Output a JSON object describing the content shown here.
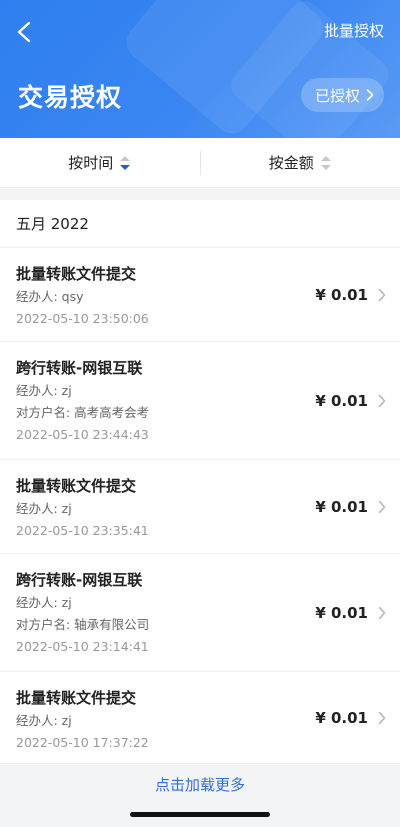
{
  "header": {
    "back_icon": "chevron-left-icon",
    "batch_auth_label": "批量授权",
    "title": "交易授权",
    "authorized_label": "已授权",
    "colors": {
      "header_blue": "#3a86f2",
      "link_blue": "#2f6fd6",
      "sort_active": "#1f5fc7"
    }
  },
  "sort_bar": {
    "items": [
      {
        "label": "按时间",
        "state": "descending"
      },
      {
        "label": "按金额",
        "state": "none"
      }
    ]
  },
  "list": {
    "month": "五月 2022",
    "rows": [
      {
        "title": "批量转账文件提交",
        "handler": "经办人: qsy",
        "counterparty": "",
        "time": "2022-05-10 23:50:06",
        "amount": "¥ 0.01"
      },
      {
        "title": "跨行转账-网银互联",
        "handler": "经办人: zj",
        "counterparty": "对方户名: 高考高考会考",
        "time": "2022-05-10 23:44:43",
        "amount": "¥ 0.01"
      },
      {
        "title": "批量转账文件提交",
        "handler": "经办人: zj",
        "counterparty": "",
        "time": "2022-05-10 23:35:41",
        "amount": "¥ 0.01"
      },
      {
        "title": "跨行转账-网银互联",
        "handler": "经办人: zj",
        "counterparty": "对方户名: 轴承有限公司",
        "time": "2022-05-10 23:14:41",
        "amount": "¥ 0.01"
      },
      {
        "title": "批量转账文件提交",
        "handler": "经办人: zj",
        "counterparty": "",
        "time": "2022-05-10 17:37:22",
        "amount": "¥ 0.01"
      }
    ]
  },
  "load_more_label": "点击加载更多"
}
